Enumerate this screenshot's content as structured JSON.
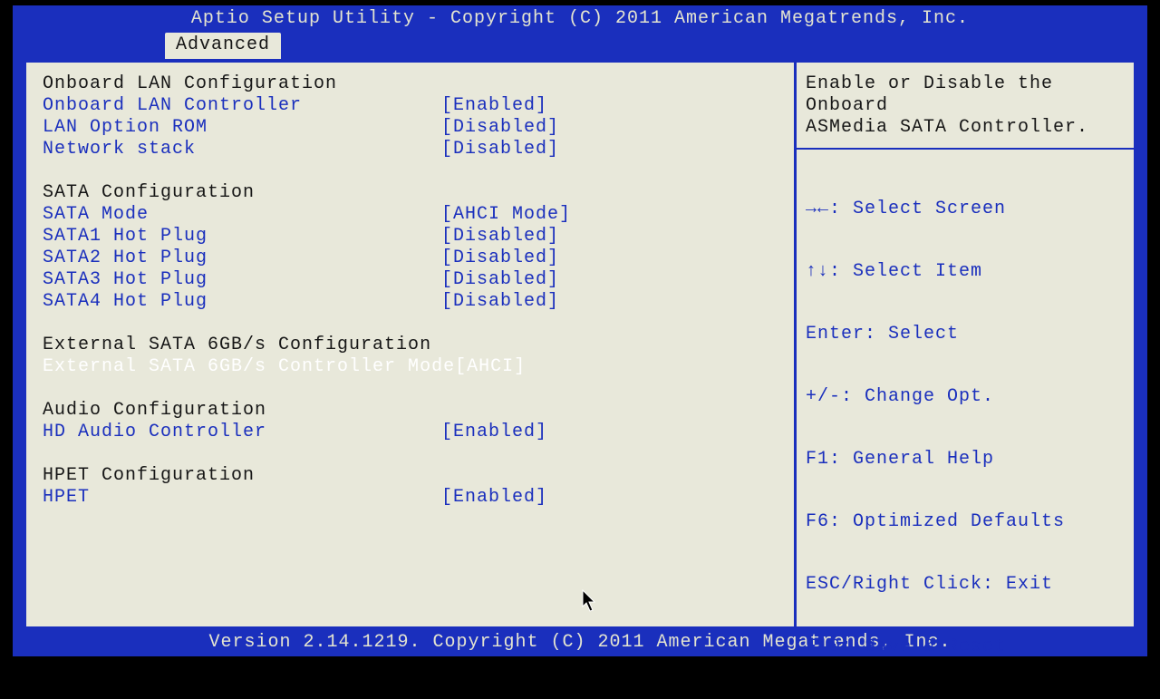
{
  "title": "Aptio Setup Utility - Copyright (C) 2011 American Megatrends, Inc.",
  "active_tab": "Advanced",
  "footer": "Version 2.14.1219. Copyright (C) 2011 American Megatrends, Inc.",
  "help_text_line1": "Enable or Disable the Onboard",
  "help_text_line2": "ASMedia SATA Controller.",
  "legend": {
    "l1": "→←: Select Screen",
    "l2": "↑↓: Select Item",
    "l3": "Enter: Select",
    "l4": "+/-: Change Opt.",
    "l5": "F1: General Help",
    "l6": "F6: Optimized Defaults",
    "l7": "ESC/Right Click: Exit",
    "l8": "F10: Save & Reset"
  },
  "sections": {
    "lan_header": "Onboard LAN Configuration",
    "lan_controller_label": "Onboard LAN Controller",
    "lan_controller_value": "[Enabled]",
    "lan_rom_label": "LAN Option ROM",
    "lan_rom_value": "[Disabled]",
    "net_stack_label": "Network stack",
    "net_stack_value": "[Disabled]",
    "sata_header": "SATA Configuration",
    "sata_mode_label": "SATA Mode",
    "sata_mode_value": "[AHCI Mode]",
    "sata1_label": "SATA1 Hot Plug",
    "sata1_value": "[Disabled]",
    "sata2_label": "SATA2 Hot Plug",
    "sata2_value": "[Disabled]",
    "sata3_label": "SATA3 Hot Plug",
    "sata3_value": "[Disabled]",
    "sata4_label": "SATA4 Hot Plug",
    "sata4_value": "[Disabled]",
    "ext_sata_header": "External SATA 6GB/s Configuration",
    "ext_sata_label": "External SATA 6GB/s Controller Mode",
    "ext_sata_value": "[AHCI]",
    "audio_header": "Audio Configuration",
    "audio_label": "HD Audio Controller",
    "audio_value": "[Enabled]",
    "hpet_header": "HPET Configuration",
    "hpet_label": "HPET",
    "hpet_value": "[Enabled]"
  }
}
